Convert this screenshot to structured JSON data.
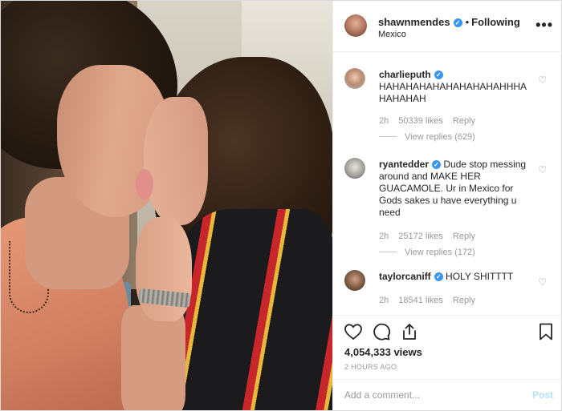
{
  "header": {
    "username": "shawnmendes",
    "follow_label": "Following",
    "location": "Mexico",
    "more_label": "•••"
  },
  "comments": [
    {
      "username": "charlieputh",
      "text": "HAHAHAHAHAHAHAHAHAHHHAHAHAHAH",
      "time": "2h",
      "likes": "50339 likes",
      "reply_label": "Reply",
      "view_replies": "View replies (629)"
    },
    {
      "username": "ryantedder",
      "text": "Dude stop messing around and MAKE HER GUACAMOLE. Ur in Mexico for Gods sakes u have everything u need",
      "time": "2h",
      "likes": "25172 likes",
      "reply_label": "Reply",
      "view_replies": "View replies (172)"
    },
    {
      "username": "taylorcaniff",
      "text": "HOLY SHITTTT",
      "time": "2h",
      "likes": "18541 likes",
      "reply_label": "Reply"
    }
  ],
  "actions": {
    "views": "4,054,333 views",
    "time_ago": "2 HOURS AGO"
  },
  "add_comment": {
    "placeholder": "Add a comment...",
    "post_label": "Post"
  },
  "colors": {
    "verified": "#3897f0",
    "muted": "#999999",
    "post_disabled": "#b2dffc"
  }
}
